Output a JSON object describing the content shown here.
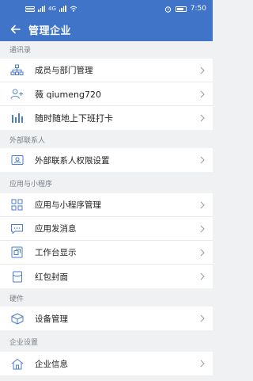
{
  "statusbar": {
    "time": "7:50",
    "net": "4G"
  },
  "nav": {
    "title": "管理企业"
  },
  "sections": [
    {
      "label": "通讯录",
      "items": [
        {
          "icon": "org-chart-icon",
          "label": "成员与部门管理"
        },
        {
          "icon": "add-user-icon",
          "label": "薇 qiumeng720"
        },
        {
          "icon": "bar-chart-icon",
          "label": "随时随地上下班打卡"
        }
      ]
    },
    {
      "label": "外部联系人",
      "items": [
        {
          "icon": "contact-card-icon",
          "label": "外部联系人权限设置"
        }
      ]
    },
    {
      "label": "应用与小程序",
      "items": [
        {
          "icon": "apps-grid-icon",
          "label": "应用与小程序管理"
        },
        {
          "icon": "message-icon",
          "label": "应用发消息"
        },
        {
          "icon": "workspace-icon",
          "label": "工作台显示"
        },
        {
          "icon": "red-envelope-icon",
          "label": "红包封面"
        }
      ]
    },
    {
      "label": "硬件",
      "items": [
        {
          "icon": "device-box-icon",
          "label": "设备管理"
        }
      ]
    },
    {
      "label": "企业设置",
      "items": [
        {
          "icon": "home-icon",
          "label": "企业信息"
        }
      ]
    }
  ],
  "colors": {
    "primary": "#3f74c8",
    "icon": "#4a7bd0",
    "background": "#f0f1f3"
  }
}
